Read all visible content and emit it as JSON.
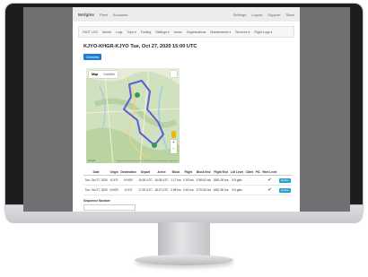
{
  "topnav": {
    "brand": "MAfghts",
    "links": [
      "Fleet",
      "Accounts"
    ],
    "right": [
      "Settings",
      "Logout",
      "Support",
      "Store"
    ]
  },
  "subnav": {
    "items": [
      "FAST LOG",
      "Month",
      "Logs",
      "Trips ▾",
      "Fueling",
      "Settings ▾",
      "Users",
      "Organizations",
      "Maintenance ▾",
      "Services ▾",
      "Flight Logs ▾"
    ]
  },
  "page": {
    "title": "KJYO-KHGR-KJYO Tue, Oct 27, 2020 15:00 UTC",
    "overview_button": "Overview"
  },
  "map": {
    "tab_map": "Map",
    "tab_satellite": "Satellite",
    "footer_left": "Google",
    "footer_right": "Keyboard shortcuts  Map data ©2020  Terms of Use  Report a map error",
    "zoom_in": "+",
    "zoom_out": "−"
  },
  "table": {
    "headers": [
      "Date",
      "Origin",
      "Destination",
      "Depart",
      "Arrive",
      "Block",
      "Flight",
      "Block End",
      "Flight End",
      "Ldt Level",
      "Client",
      "PIC",
      "Rent Level",
      ""
    ],
    "rows": [
      [
        "Tue, Oct 27, 2020",
        "KJYO",
        "KHGR",
        "15:00 UTC",
        "16:05 UTC",
        "1.17 hrs",
        "0.93 hrs",
        "1769.62 hrs",
        "1681.09 hrs",
        "5.5 gals",
        "",
        "",
        "✔",
        "Delete"
      ],
      [
        "Tue, Oct 27, 2020",
        "KHGR",
        "KJYO",
        "17:20 UTC",
        "18:27 UTC",
        "0.98 hrs",
        "0.81 hrs",
        "1770.60 hrs",
        "1681.90 hrs",
        "5.5 gals",
        "",
        "",
        "✔",
        "Delete"
      ]
    ]
  },
  "sequence": {
    "label": "Sequence Number",
    "value": ""
  },
  "colors": {
    "accent": "#1a7fd0",
    "route": "#5b5fd6",
    "check": "#2e9d55"
  }
}
